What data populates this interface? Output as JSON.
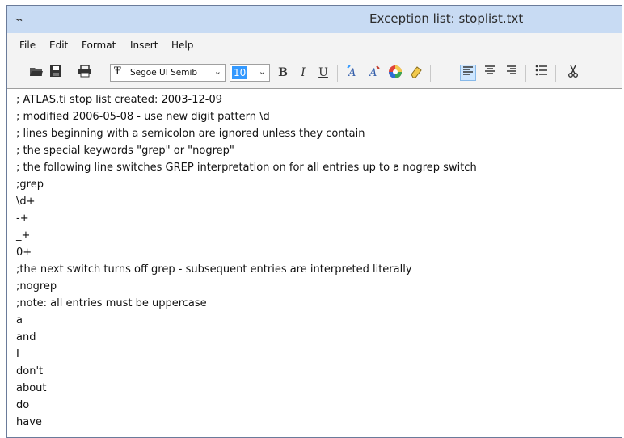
{
  "window": {
    "title": "Exception list: stoplist.txt",
    "icon": "atlas-app-icon"
  },
  "menu": {
    "items": [
      "File",
      "Edit",
      "Format",
      "Insert",
      "Help"
    ]
  },
  "toolbar": {
    "font_name": "Segoe UI Semib",
    "font_size": "10",
    "bold_label": "B",
    "italic_label": "I",
    "underline_label": "U",
    "icons": [
      "open-folder-icon",
      "save-icon",
      "print-icon",
      "font-icon",
      "font-size-icon",
      "bold-icon",
      "italic-icon",
      "underline-icon",
      "text-color-icon",
      "highlight-color-icon",
      "color-wheel-icon",
      "eraser-icon",
      "align-left-icon",
      "align-center-icon",
      "align-right-icon",
      "bullet-list-icon",
      "cut-icon"
    ],
    "active_alignment": "left",
    "colors": {
      "highlight_blue": "#3399ff",
      "color_wheel": "#e0433a",
      "eraser": "#f2c94c"
    }
  },
  "editor": {
    "lines": [
      "; ATLAS.ti stop list created: 2003-12-09",
      "; modified 2006-05-08 - use new digit pattern \\d",
      "; lines beginning with a semicolon are ignored unless they contain",
      "; the special keywords \"grep\" or \"nogrep\"",
      "; the following line switches GREP interpretation on for all entries up to a nogrep switch",
      ";grep",
      "\\d+",
      "-+",
      "_+",
      "0+",
      ";the next switch turns off grep - subsequent entries are interpreted literally",
      ";nogrep",
      ";note: all entries must be uppercase",
      "a",
      "and",
      "I",
      "don't",
      "about",
      "do",
      "have"
    ]
  }
}
